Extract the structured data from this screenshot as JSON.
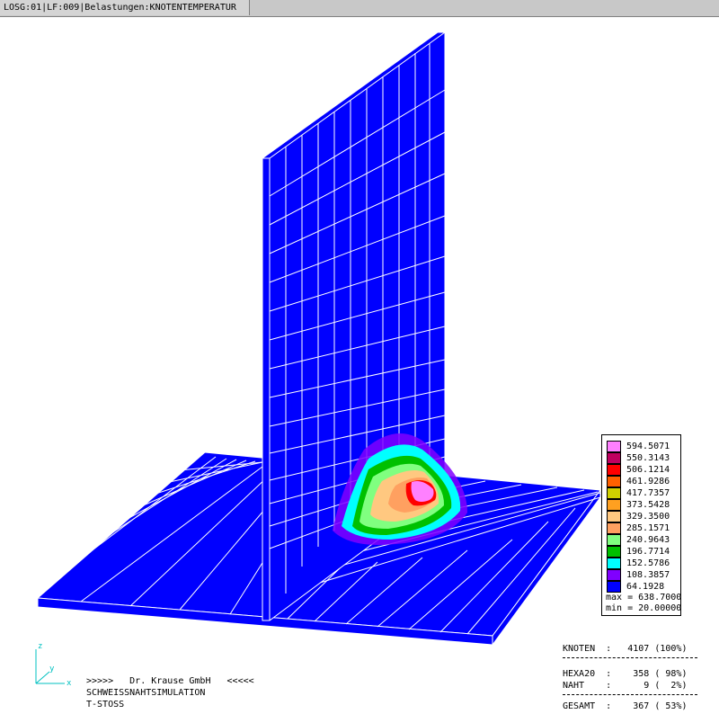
{
  "titlebar": {
    "text": "LOSG:01|LF:009|Belastungen:KNOTENTEMPERATUR"
  },
  "legend": {
    "entries": [
      {
        "value": "594.5071",
        "color": "#ff80ff"
      },
      {
        "value": "550.3143",
        "color": "#c00060"
      },
      {
        "value": "506.1214",
        "color": "#ff0000"
      },
      {
        "value": "461.9286",
        "color": "#ff6000"
      },
      {
        "value": "417.7357",
        "color": "#d0d000"
      },
      {
        "value": "373.5428",
        "color": "#ffa020"
      },
      {
        "value": "329.3500",
        "color": "#ffc880"
      },
      {
        "value": "285.1571",
        "color": "#ffa060"
      },
      {
        "value": "240.9643",
        "color": "#80ff80"
      },
      {
        "value": "196.7714",
        "color": "#00c000"
      },
      {
        "value": "152.5786",
        "color": "#00ffff"
      },
      {
        "value": "108.3857",
        "color": "#8000ff"
      },
      {
        "value": "64.1928",
        "color": "#0000ff"
      }
    ],
    "max": "max = 638.7000",
    "min": "min = 20.00000"
  },
  "stats": {
    "knoten": "KNOTEN  :   4107 (100%)",
    "hexa": "HEXA20  :    358 ( 98%)",
    "naht": "NAHT    :      9 (  2%)",
    "gesamt": "GESAMT  :    367 ( 53%)"
  },
  "company": {
    "line1": ">>>>>   Dr. Krause GmbH   <<<<<",
    "line2": "SCHWEISSNAHTSIMULATION",
    "line3": "T-STOSS"
  },
  "axes": {
    "z": "z",
    "y": "y",
    "x": "x"
  },
  "colors": {
    "mesh_blue": "#0000ff",
    "mesh_line": "#ffffff"
  }
}
